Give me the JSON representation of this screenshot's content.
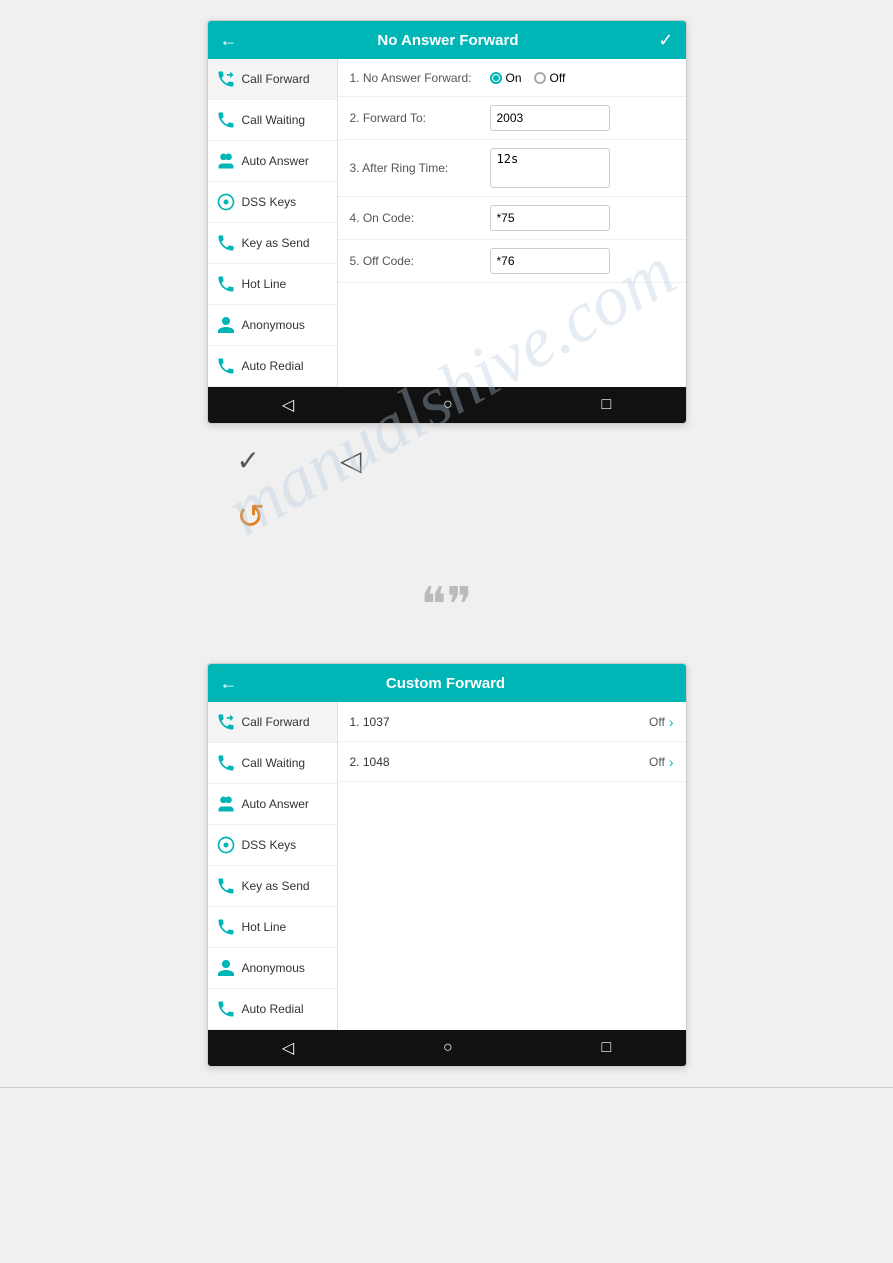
{
  "screen1": {
    "title": "No Answer Forward",
    "back_label": "←",
    "check_label": "✓",
    "sidebar": {
      "items": [
        {
          "label": "Call Forward",
          "icon": "call-forward-icon",
          "active": true
        },
        {
          "label": "Call Waiting",
          "icon": "call-waiting-icon",
          "active": false
        },
        {
          "label": "Auto Answer",
          "icon": "auto-answer-icon",
          "active": false
        },
        {
          "label": "DSS Keys",
          "icon": "dss-keys-icon",
          "active": false
        },
        {
          "label": "Key as Send",
          "icon": "key-as-send-icon",
          "active": false
        },
        {
          "label": "Hot Line",
          "icon": "hot-line-icon",
          "active": false
        },
        {
          "label": "Anonymous",
          "icon": "anonymous-icon",
          "active": false
        },
        {
          "label": "Auto Redial",
          "icon": "auto-redial-icon",
          "active": false
        }
      ]
    },
    "form": {
      "rows": [
        {
          "label": "1. No Answer Forward:",
          "type": "radio",
          "options": [
            "On",
            "Off"
          ],
          "selected": "On"
        },
        {
          "label": "2. Forward To:",
          "type": "text",
          "value": "2003"
        },
        {
          "label": "3. After Ring Time:",
          "type": "textarea",
          "value": "12s"
        },
        {
          "label": "4. On Code:",
          "type": "text",
          "value": "*75"
        },
        {
          "label": "5. Off Code:",
          "type": "text",
          "value": "*76"
        }
      ]
    },
    "nav": {
      "back": "◁",
      "home": "○",
      "square": "□"
    }
  },
  "icons_section": {
    "check_icon": "✓",
    "back_icon": "◁",
    "refresh_icon": "↺"
  },
  "quotes_section": {
    "icon": "❝❞"
  },
  "screen2": {
    "title": "Custom Forward",
    "back_label": "←",
    "sidebar": {
      "items": [
        {
          "label": "Call Forward",
          "icon": "call-forward-icon",
          "active": true
        },
        {
          "label": "Call Waiting",
          "icon": "call-waiting-icon",
          "active": false
        },
        {
          "label": "Auto Answer",
          "icon": "auto-answer-icon",
          "active": false
        },
        {
          "label": "DSS Keys",
          "icon": "dss-keys-icon",
          "active": false
        },
        {
          "label": "Key as Send",
          "icon": "key-as-send-icon",
          "active": false
        },
        {
          "label": "Hot Line",
          "icon": "hot-line-icon",
          "active": false
        },
        {
          "label": "Anonymous",
          "icon": "anonymous-icon",
          "active": false
        },
        {
          "label": "Auto Redial",
          "icon": "auto-redial-icon",
          "active": false
        }
      ]
    },
    "content_rows": [
      {
        "number": "1.",
        "label": "1037",
        "value": "Off"
      },
      {
        "number": "2.",
        "label": "1048",
        "value": "Off"
      }
    ],
    "nav": {
      "back": "◁",
      "home": "○",
      "square": "□"
    }
  },
  "watermark": {
    "line1": "manualshive.com"
  }
}
